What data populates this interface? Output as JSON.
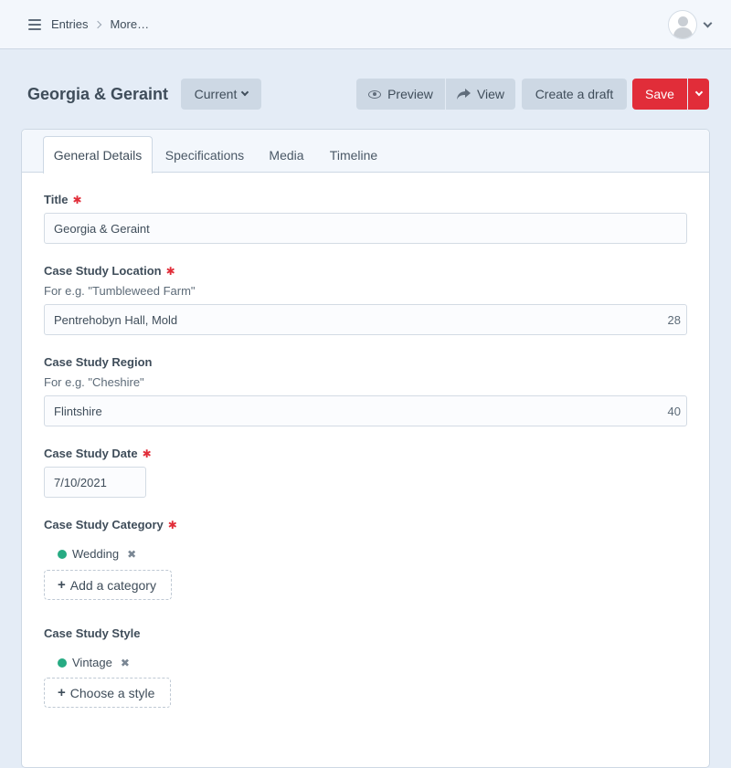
{
  "nav": {
    "breadcrumbs": [
      "Entries",
      "More…"
    ]
  },
  "header": {
    "title": "Georgia & Geraint",
    "status_label": "Current",
    "preview_label": "Preview",
    "view_label": "View",
    "create_draft_label": "Create a draft",
    "save_label": "Save"
  },
  "tabs": [
    "General Details",
    "Specifications",
    "Media",
    "Timeline"
  ],
  "form": {
    "title": {
      "label": "Title",
      "value": "Georgia & Geraint"
    },
    "location": {
      "label": "Case Study Location",
      "hint": "For e.g. \"Tumbleweed Farm\"",
      "value": "Pentrehobyn Hall, Mold",
      "counter": "28"
    },
    "region": {
      "label": "Case Study Region",
      "hint": "For e.g. \"Cheshire\"",
      "value": "Flintshire",
      "counter": "40"
    },
    "date": {
      "label": "Case Study Date",
      "value": "7/10/2021"
    },
    "category": {
      "label": "Case Study Category",
      "selected": "Wedding",
      "add_label": "Add a category"
    },
    "style": {
      "label": "Case Study Style",
      "selected": "Vintage",
      "add_label": "Choose a style"
    }
  },
  "colors": {
    "accent_red": "#e12d39",
    "status_green": "#27ab83",
    "button_gray": "#cdd8e4"
  }
}
